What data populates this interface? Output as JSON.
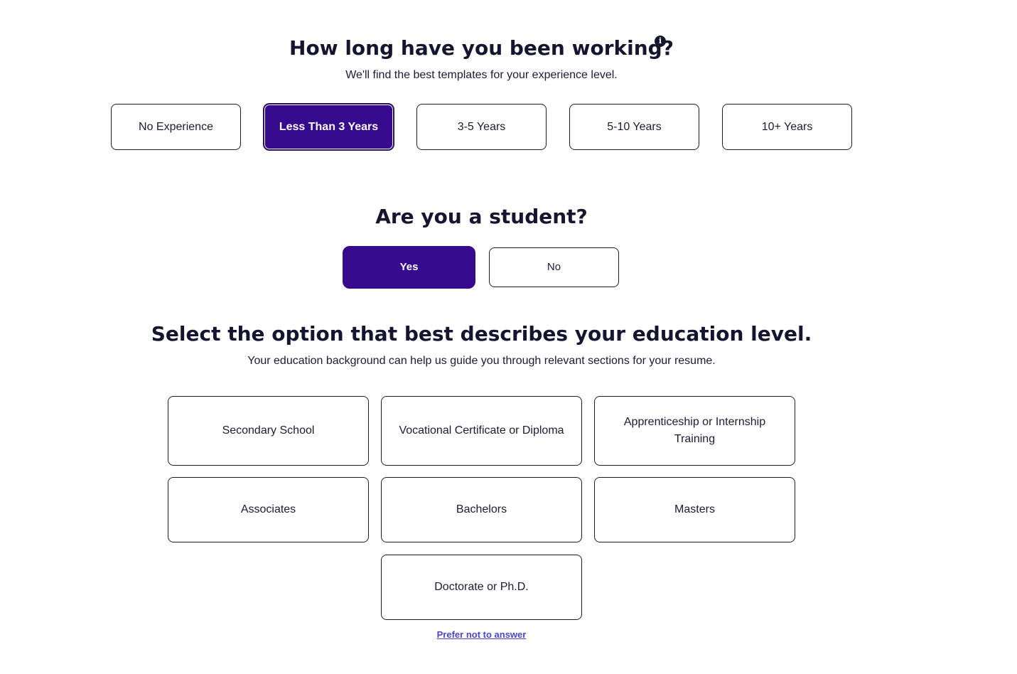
{
  "experience": {
    "title": "How long have you been working?",
    "subtitle": "We'll find the best templates for your experience level.",
    "info_icon": "info-circle-icon",
    "options": [
      {
        "label": "No Experience",
        "selected": false
      },
      {
        "label": "Less Than 3 Years",
        "selected": true
      },
      {
        "label": "3-5 Years",
        "selected": false
      },
      {
        "label": "5-10 Years",
        "selected": false
      },
      {
        "label": "10+ Years",
        "selected": false
      }
    ]
  },
  "student": {
    "title": "Are you a student?",
    "options": [
      {
        "label": "Yes",
        "selected": true
      },
      {
        "label": "No",
        "selected": false
      }
    ]
  },
  "education": {
    "title": "Select the option that best describes your education level.",
    "subtitle": "Your education background can help us guide you through relevant sections for your resume.",
    "options": [
      {
        "label": "Secondary School"
      },
      {
        "label": "Vocational Certificate or Diploma"
      },
      {
        "label": "Apprenticeship or Internship Training"
      },
      {
        "label": "Associates"
      },
      {
        "label": "Bachelors"
      },
      {
        "label": "Masters"
      },
      {
        "label": "Doctorate or Ph.D."
      }
    ],
    "skip_link": "Prefer not to answer"
  },
  "colors": {
    "accent": "#350a8c",
    "text": "#1c1a33",
    "link": "#4a45c9",
    "background": "#ffffff"
  }
}
